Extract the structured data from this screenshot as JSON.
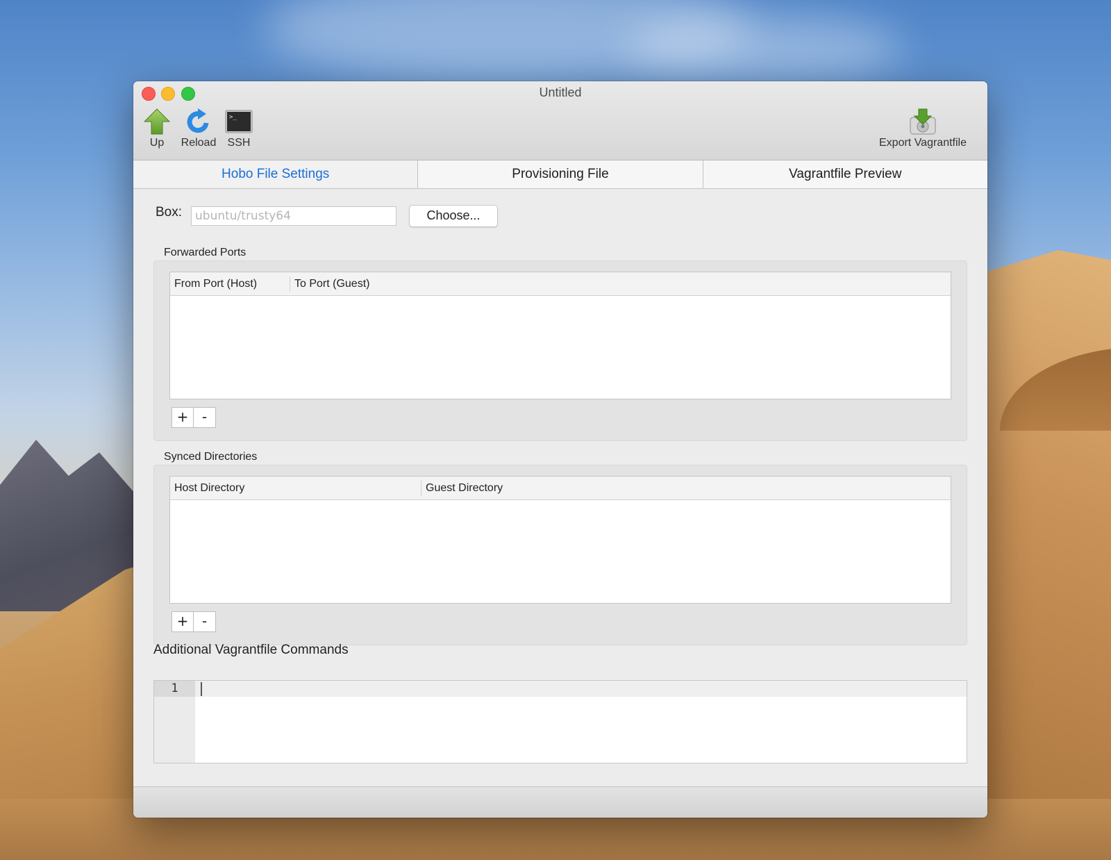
{
  "window": {
    "title": "Untitled"
  },
  "toolbar": {
    "up_label": "Up",
    "reload_label": "Reload",
    "ssh_label": "SSH",
    "export_label": "Export Vagrantfile"
  },
  "tabs": [
    {
      "label": "Hobo File Settings",
      "active": true
    },
    {
      "label": "Provisioning File",
      "active": false
    },
    {
      "label": "Vagrantfile Preview",
      "active": false
    }
  ],
  "settings": {
    "box_label": "Box:",
    "box_placeholder": "ubuntu/trusty64",
    "box_value": "",
    "choose_label": "Choose..."
  },
  "forwarded_ports": {
    "title": "Forwarded Ports",
    "columns": [
      "From Port (Host)",
      "To Port (Guest)"
    ],
    "rows": [],
    "add_label": "+",
    "remove_label": "-"
  },
  "synced_directories": {
    "title": "Synced Directories",
    "columns": [
      "Host Directory",
      "Guest Directory"
    ],
    "rows": [],
    "add_label": "+",
    "remove_label": "-"
  },
  "additional_commands": {
    "title": "Additional Vagrantfile Commands",
    "line_numbers": [
      "1"
    ],
    "content": ""
  },
  "colors": {
    "active_tab": "#1c6ed6",
    "close": "#fc5e57",
    "minimize": "#fdbc2e",
    "zoom": "#33c748"
  }
}
